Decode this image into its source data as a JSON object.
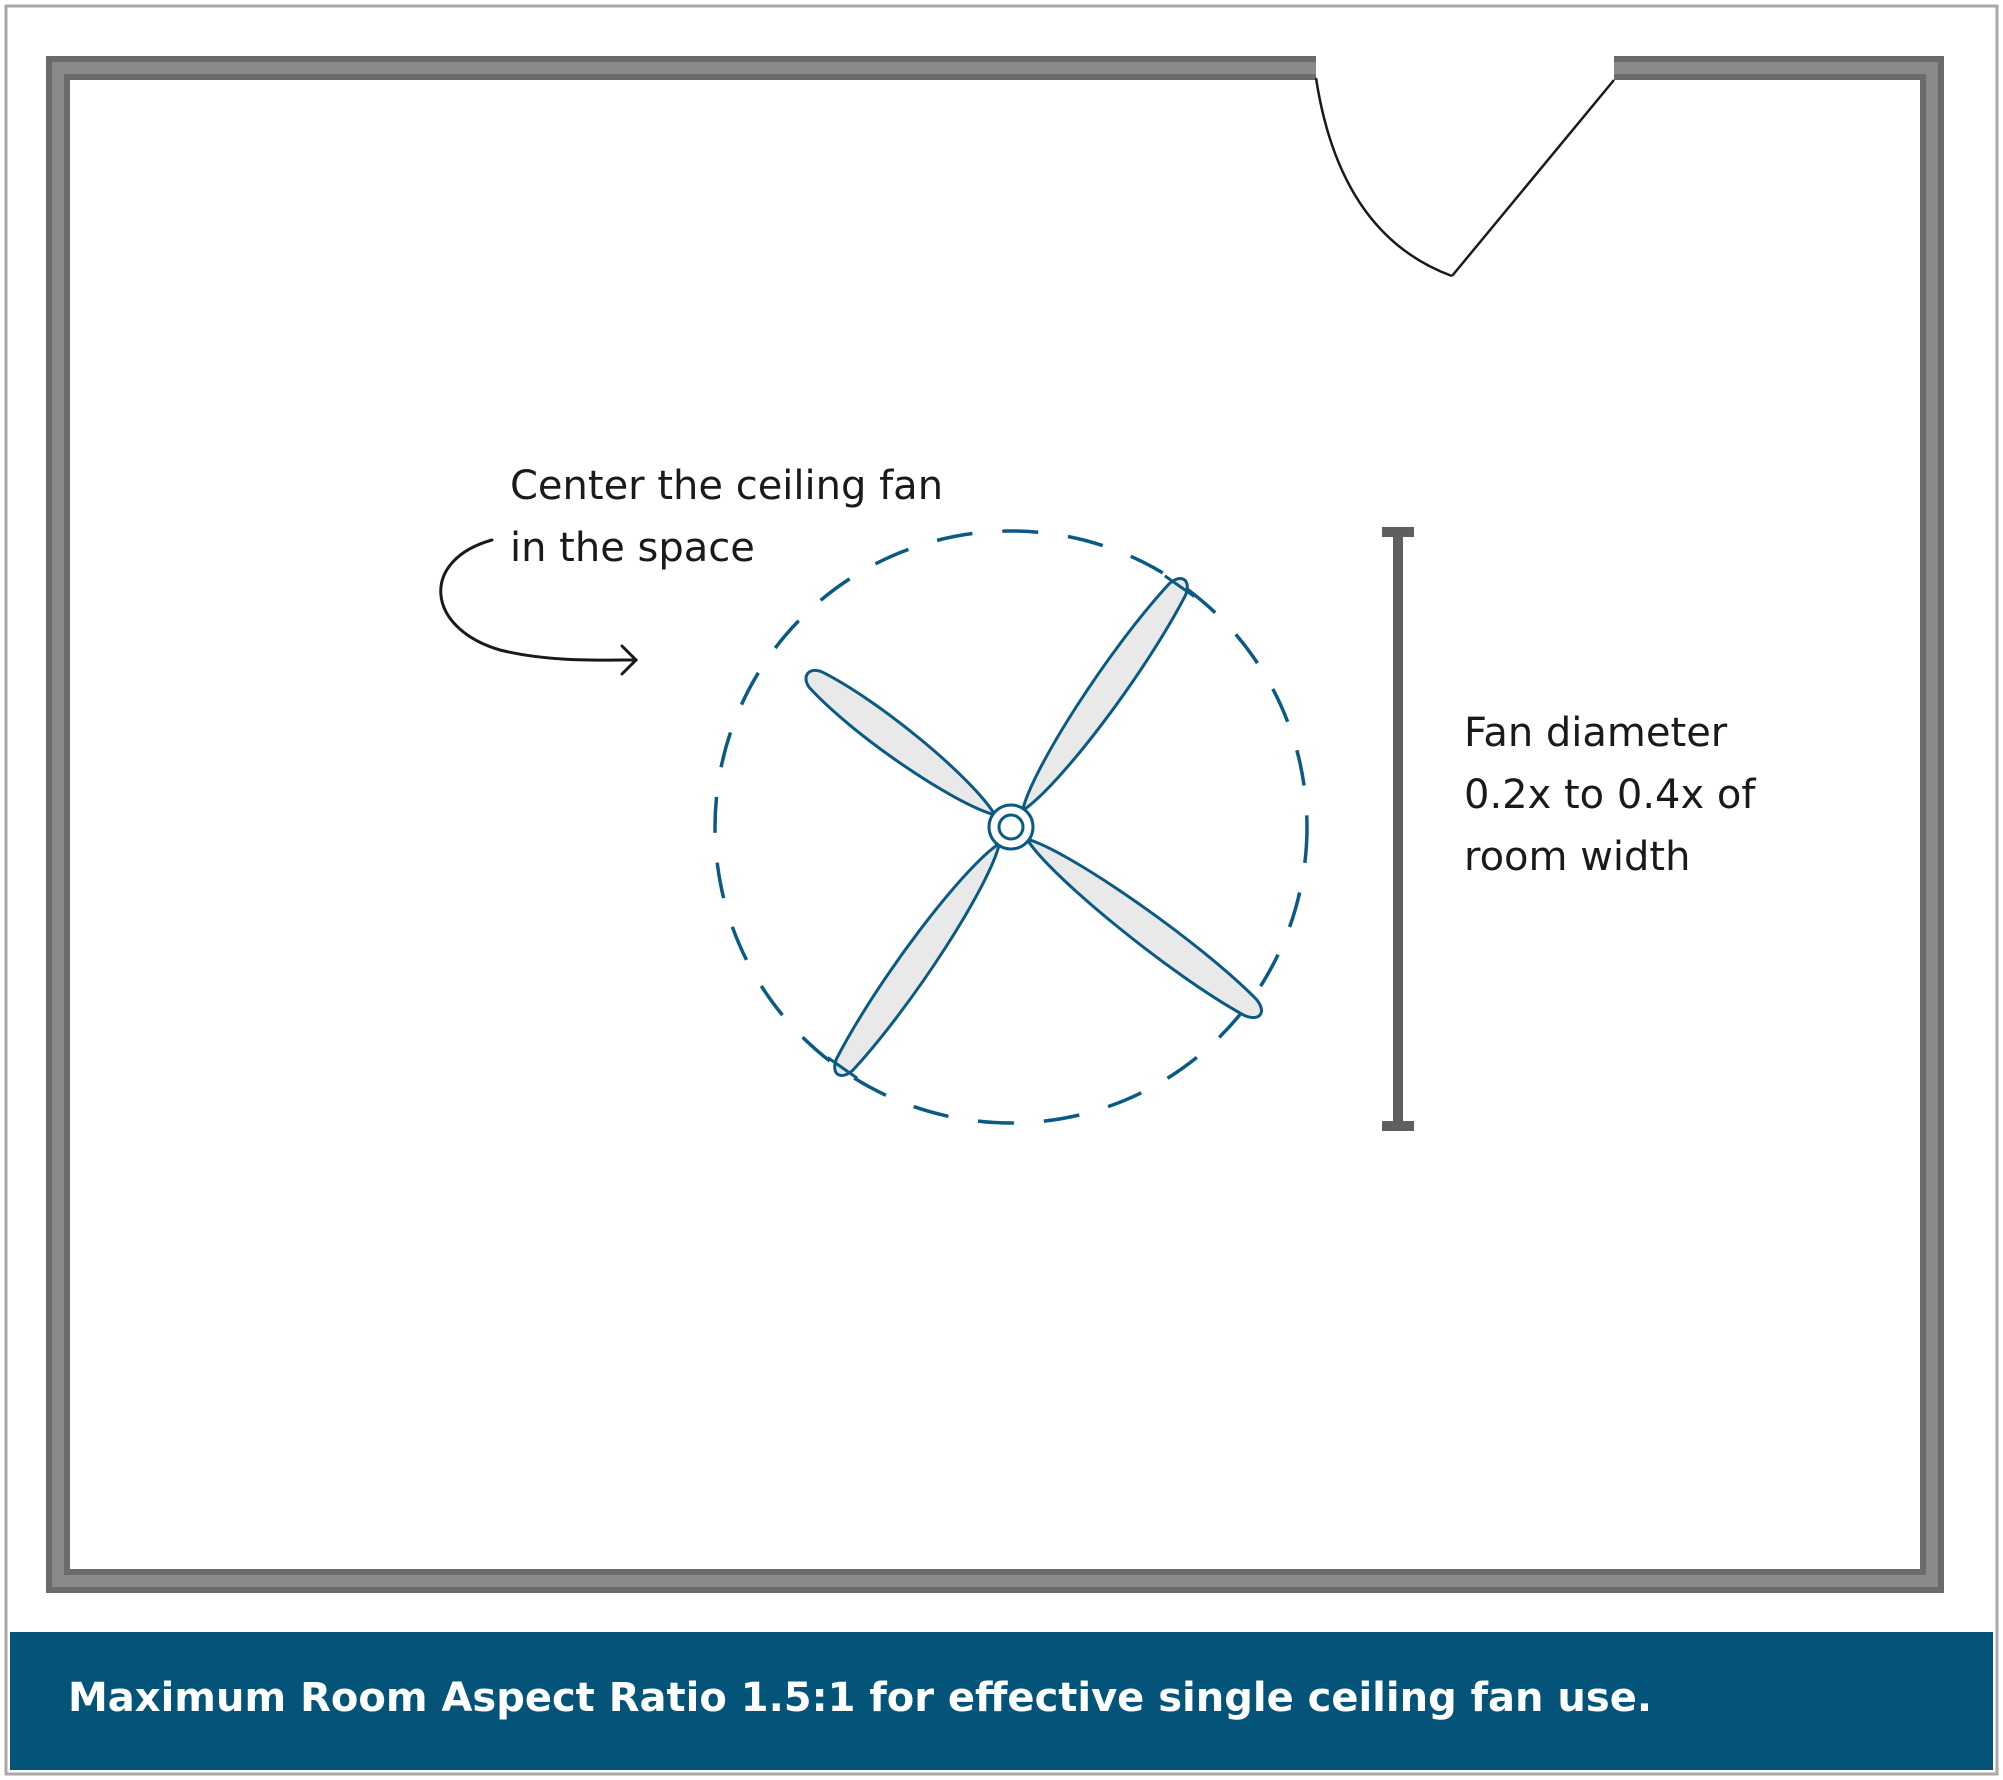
{
  "annotations": {
    "center_label": {
      "lines": [
        "Center the ceiling fan",
        "in the space"
      ]
    },
    "diameter_label": {
      "lines": [
        "Fan diameter",
        "0.2x to 0.4x of",
        "room width"
      ]
    }
  },
  "caption": "Maximum Room Aspect Ratio 1.5:1 for effective single ceiling fan use.",
  "colors": {
    "wall": "#6b6b6b",
    "fan_outline": "#0a5a84",
    "blade_fill": "#e9e9e9",
    "caption_bar": "#04547a",
    "frame_border": "#a8a8a8"
  }
}
